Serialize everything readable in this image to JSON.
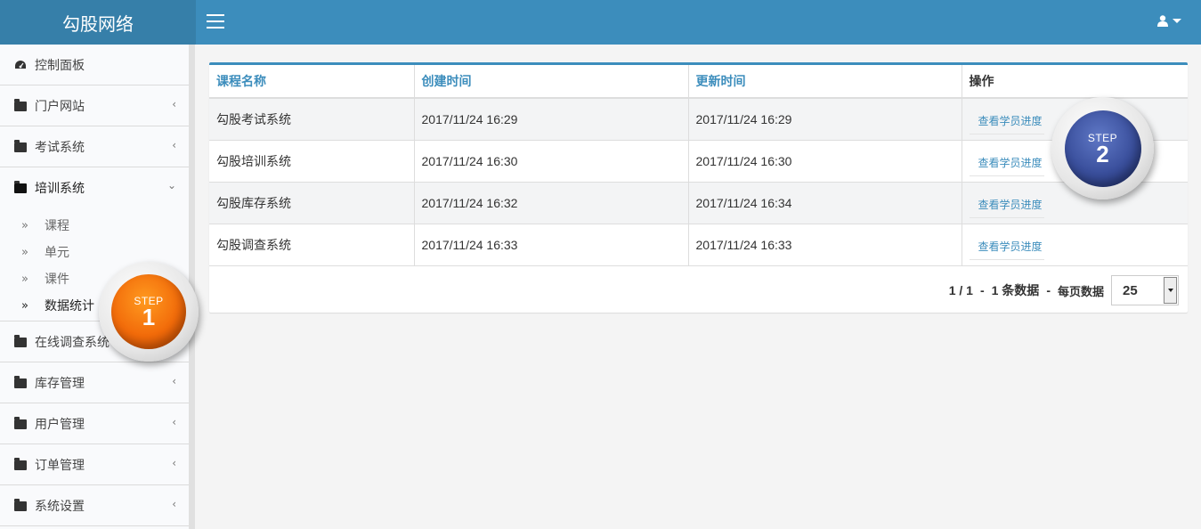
{
  "brand": "勾股网络",
  "sidebar": {
    "items": [
      {
        "label": "控制面板"
      },
      {
        "label": "门户网站"
      },
      {
        "label": "考试系统"
      },
      {
        "label": "培训系统"
      },
      {
        "label": "在线调查系统"
      },
      {
        "label": "库存管理"
      },
      {
        "label": "用户管理"
      },
      {
        "label": "订单管理"
      },
      {
        "label": "系统设置"
      }
    ],
    "submenu": [
      {
        "label": "课程"
      },
      {
        "label": "单元"
      },
      {
        "label": "课件"
      },
      {
        "label": "数据统计"
      }
    ]
  },
  "table": {
    "headers": [
      "课程名称",
      "创建时间",
      "更新时间",
      "操作"
    ],
    "rows": [
      {
        "name": "勾股考试系统",
        "created": "2017/11/24 16:29",
        "updated": "2017/11/24 16:29",
        "action": "查看学员进度"
      },
      {
        "name": "勾股培训系统",
        "created": "2017/11/24 16:30",
        "updated": "2017/11/24 16:30",
        "action": "查看学员进度"
      },
      {
        "name": "勾股库存系统",
        "created": "2017/11/24 16:32",
        "updated": "2017/11/24 16:34",
        "action": "查看学员进度"
      },
      {
        "name": "勾股调查系统",
        "created": "2017/11/24 16:33",
        "updated": "2017/11/24 16:33",
        "action": "查看学员进度"
      }
    ]
  },
  "pager": {
    "pages": "1 / 1",
    "sep": "-",
    "count": "1 条数据",
    "sep2": "-",
    "per_page_label": "每页数据",
    "per_page_value": "25"
  },
  "steps": {
    "step1": {
      "word": "STEP",
      "num": "1",
      "color": "#f26b0a"
    },
    "step2": {
      "word": "STEP",
      "num": "2",
      "color": "#3a4f9c"
    }
  },
  "icons": {
    "dashboard": "dashboard-icon",
    "folder": "folder-icon",
    "user": "user-icon",
    "menu": "hamburger-icon"
  },
  "colors": {
    "header": "#3c8dbc",
    "logo_bg": "#367fa9",
    "link": "#3c8dbc"
  }
}
